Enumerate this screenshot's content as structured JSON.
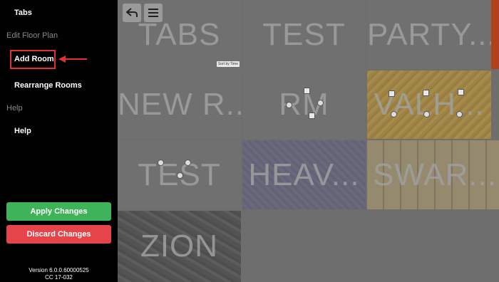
{
  "sidebar": {
    "tabs_label": "Tabs",
    "edit_floor_plan_header": "Edit Floor Plan",
    "add_room_label": "Add Room",
    "rearrange_rooms_label": "Rearrange Rooms",
    "help_header": "Help",
    "help_label": "Help",
    "apply_label": "Apply Changes",
    "discard_label": "Discard Changes",
    "version": "Version 6.0.0.60000525",
    "cc": "CC 17-032"
  },
  "colors": {
    "apply": "#3fb35a",
    "discard": "#e5454a",
    "highlight": "#e03030"
  },
  "toolbar": {
    "back_icon": "back-arrow-icon",
    "menu_icon": "hamburger-menu-icon",
    "sort_tag": "Sort by Time"
  },
  "rooms": [
    {
      "label": "TABS"
    },
    {
      "label": "TEST"
    },
    {
      "label": "PARTY..."
    },
    {
      "label": "NEW R..."
    },
    {
      "label": "RM"
    },
    {
      "label": "VALH..."
    },
    {
      "label": "TEST"
    },
    {
      "label": "HEAV..."
    },
    {
      "label": "SWAR..."
    },
    {
      "label": "ZION"
    }
  ]
}
